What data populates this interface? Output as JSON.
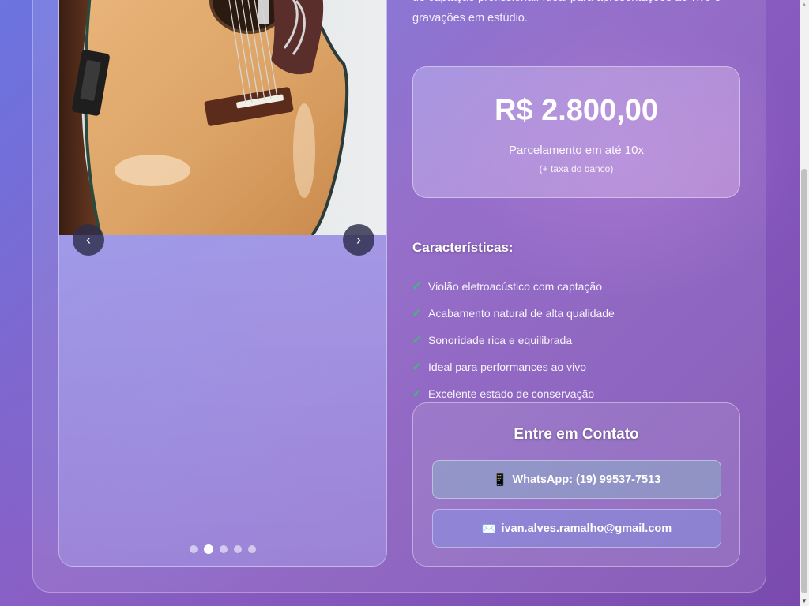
{
  "product": {
    "description": "de captação profissional. Ideal para apresentações ao vivo e gravações em estúdio.",
    "gallery": {
      "prev_label": "‹",
      "next_label": "›",
      "slide_count": 5,
      "active_slide": 2
    }
  },
  "price_card": {
    "price": "R$ 2.800,00",
    "installments": "Parcelamento em até 10x",
    "bank_fee": "(+ taxa do banco)"
  },
  "features": {
    "title": "Características:",
    "check_icon": "✓",
    "items": [
      "Violão eletroacústico com captação",
      "Acabamento natural de alta qualidade",
      "Sonoridade rica e equilibrada",
      "Ideal para performances ao vivo",
      "Excelente estado de conservação"
    ]
  },
  "contact": {
    "title": "Entre em Contato",
    "whatsapp": {
      "icon": "📱",
      "label": "WhatsApp: (19) 99537-7513"
    },
    "email": {
      "icon": "✉️",
      "label": "ivan.alves.ramalho@gmail.com"
    }
  },
  "colors": {
    "accent_check": "#2ec76a",
    "background_start": "#6b74e0",
    "background_end": "#7a4aae"
  }
}
